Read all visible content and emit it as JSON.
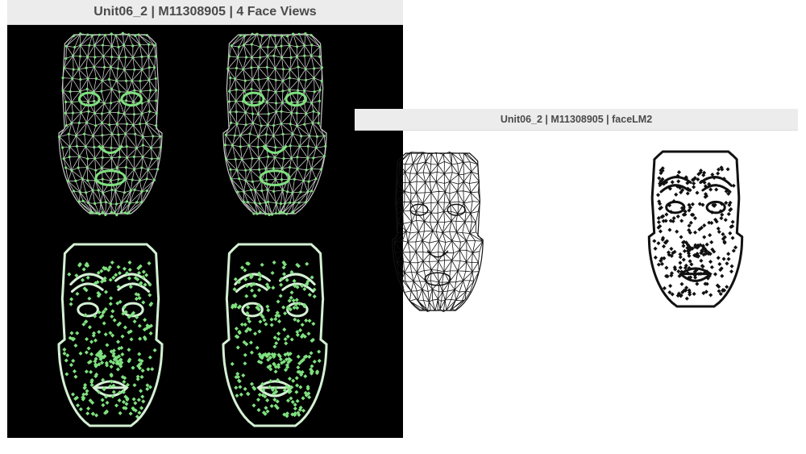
{
  "windows": [
    {
      "title": "Unit06_2 | M11308905 | 4 Face Views"
    },
    {
      "title": "Unit06_2 | M11308905 | faceLM2"
    }
  ],
  "colors": {
    "canvas_dark": "#000000",
    "landmark_green": "#7fe07f",
    "mesh_gray": "#c8c8c8",
    "outline_light": "#d4f0d4",
    "ink_black": "#111111",
    "titlebar_bg": "#ececec"
  },
  "views": {
    "window1": [
      "mesh",
      "mesh",
      "landmarks",
      "landmarks"
    ],
    "window2": [
      "mesh",
      "landmarks"
    ]
  }
}
